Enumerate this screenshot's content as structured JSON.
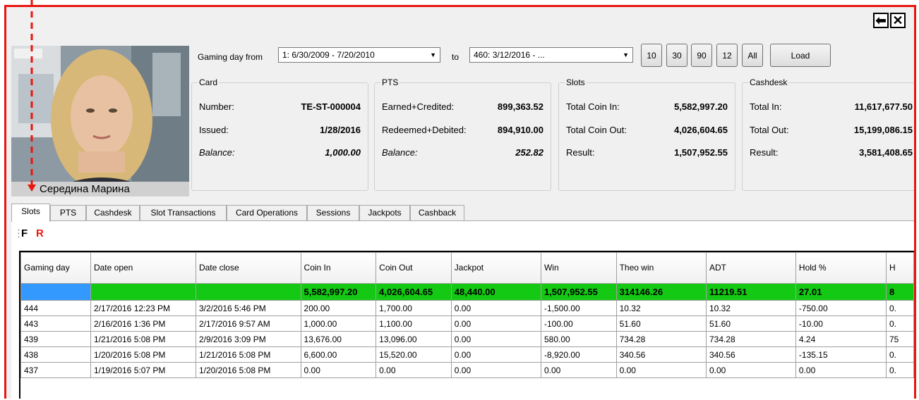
{
  "player": {
    "name": "Середина Марина"
  },
  "window": {
    "back_icon": "arrow-left-icon",
    "close_icon": "close-icon"
  },
  "filter": {
    "gaming_day_label": "Gaming day from",
    "from_value": "1: 6/30/2009 - 7/20/2010",
    "to_label": "to",
    "to_value": "460: 3/12/2016 - ...",
    "quick_buttons": [
      "10",
      "30",
      "90",
      "12",
      "All"
    ],
    "load_label": "Load"
  },
  "card": {
    "title": "Card",
    "number_label": "Number:",
    "number_value": "TE-ST-000004",
    "issued_label": "Issued:",
    "issued_value": "1/28/2016",
    "balance_label": "Balance:",
    "balance_value": "1,000.00"
  },
  "pts": {
    "title": "PTS",
    "earned_label": "Earned+Credited:",
    "earned_value": "899,363.52",
    "redeemed_label": "Redeemed+Debited:",
    "redeemed_value": "894,910.00",
    "balance_label": "Balance:",
    "balance_value": "252.82"
  },
  "slots": {
    "title": "Slots",
    "coin_in_label": "Total Coin In:",
    "coin_in_value": "5,582,997.20",
    "coin_out_label": "Total Coin Out:",
    "coin_out_value": "4,026,604.65",
    "result_label": "Result:",
    "result_value": "1,507,952.55"
  },
  "cashdesk": {
    "title": "Cashdesk",
    "in_label": "Total In:",
    "in_value": "11,617,677.50",
    "out_label": "Total Out:",
    "out_value": "15,199,086.15",
    "result_label": "Result:",
    "result_value": "3,581,408.65"
  },
  "tabs": [
    "Slots",
    "PTS",
    "Cashdesk",
    "Slot Transactions",
    "Card Operations",
    "Sessions",
    "Jackpots",
    "Cashback"
  ],
  "toolbar": {
    "f_label": "F",
    "r_label": "R"
  },
  "table": {
    "headers": [
      "Gaming day",
      "Date open",
      "Date close",
      "Coin In",
      "Coin Out",
      "Jackpot",
      "Win",
      "Theo win",
      "ADT",
      "Hold %",
      "H"
    ],
    "totals": [
      "",
      "",
      "",
      "5,582,997.20",
      "4,026,604.65",
      "48,440.00",
      "1,507,952.55",
      "314146.26",
      "11219.51",
      "27.01",
      "8"
    ],
    "rows": [
      [
        "444",
        "2/17/2016 12:23 PM",
        "3/2/2016 5:46 PM",
        "200.00",
        "1,700.00",
        "0.00",
        "-1,500.00",
        "10.32",
        "10.32",
        "-750.00",
        "0."
      ],
      [
        "443",
        "2/16/2016 1:36 PM",
        "2/17/2016 9:57 AM",
        "1,000.00",
        "1,100.00",
        "0.00",
        "-100.00",
        "51.60",
        "51.60",
        "-10.00",
        "0."
      ],
      [
        "439",
        "1/21/2016 5:08 PM",
        "2/9/2016 3:09 PM",
        "13,676.00",
        "13,096.00",
        "0.00",
        "580.00",
        "734.28",
        "734.28",
        "4.24",
        "75"
      ],
      [
        "438",
        "1/20/2016 5:08 PM",
        "1/21/2016 5:08 PM",
        "6,600.00",
        "15,520.00",
        "0.00",
        "-8,920.00",
        "340.56",
        "340.56",
        "-135.15",
        "0."
      ],
      [
        "437",
        "1/19/2016 5:07 PM",
        "1/20/2016 5:08 PM",
        "0.00",
        "0.00",
        "0.00",
        "0.00",
        "0.00",
        "0.00",
        "0.00",
        "0."
      ]
    ]
  },
  "colors": {
    "frame": "#e8160e",
    "totals_row": "#14c914",
    "selected_cell": "#3399ff",
    "r_label": "#e8160e"
  }
}
